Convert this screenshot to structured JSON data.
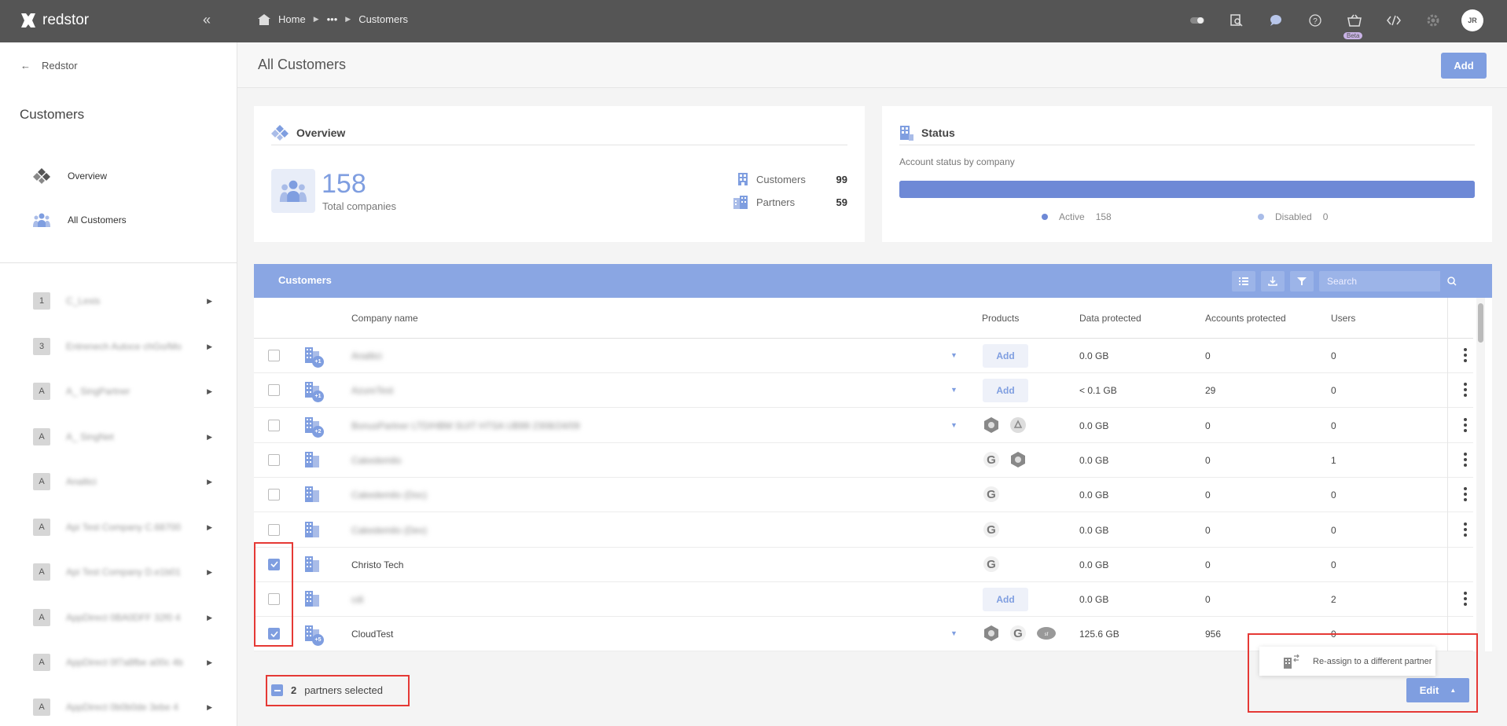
{
  "topbar": {
    "brand": "redstor",
    "breadcrumb": {
      "home": "Home",
      "ellipsis": "•••",
      "current": "Customers"
    },
    "beta_label": "Beta",
    "avatar_initials": "JR",
    "icons": [
      "toggle-icon",
      "search-doc-icon",
      "chat-icon",
      "help-icon",
      "basket-icon",
      "code-icon",
      "gear-icon"
    ]
  },
  "sidebar": {
    "back_label": "Redstor",
    "title": "Customers",
    "nav": [
      {
        "label": "Overview",
        "icon": "overview-icon"
      },
      {
        "label": "All Customers",
        "icon": "people-icon"
      }
    ],
    "list": [
      {
        "badge": "1",
        "label": "C_Lexis"
      },
      {
        "badge": "3",
        "label": "Entrenech Autoce chGo/Mo"
      },
      {
        "badge": "A",
        "label": "A_ SingPartner"
      },
      {
        "badge": "A",
        "label": "A_ SingNet"
      },
      {
        "badge": "A",
        "label": "Analtici"
      },
      {
        "badge": "A",
        "label": "Api Test Company C.68700"
      },
      {
        "badge": "A",
        "label": "Api Test Company D.e1b01"
      },
      {
        "badge": "A",
        "label": "AppDirect 0BA0DFF 32f0 4"
      },
      {
        "badge": "A",
        "label": "AppDirect 0f7a8fbe a00c 4b"
      },
      {
        "badge": "A",
        "label": "AppDirect 0b0b0de 3ebe 4"
      }
    ]
  },
  "page": {
    "title": "All Customers",
    "add_label": "Add"
  },
  "overview": {
    "title": "Overview",
    "total": "158",
    "total_label": "Total companies",
    "customers_label": "Customers",
    "customers_count": "99",
    "partners_label": "Partners",
    "partners_count": "59"
  },
  "status": {
    "title": "Status",
    "subtitle": "Account status by company",
    "active_label": "Active",
    "active_count": "158",
    "disabled_label": "Disabled",
    "disabled_count": "0",
    "active_fraction": 1.0,
    "colors": {
      "active": "#6e89d6",
      "disabled": "#a9bce8"
    }
  },
  "table": {
    "title": "Customers",
    "search_placeholder": "Search",
    "columns": {
      "name": "Company name",
      "products": "Products",
      "data": "Data protected",
      "accounts": "Accounts protected",
      "users": "Users"
    },
    "rows": [
      {
        "name": "Analtici",
        "blur": true,
        "badge": "+1",
        "caret": true,
        "products": "add",
        "data": "0.0 GB",
        "accounts": "0",
        "users": "0",
        "checked": false,
        "kebab": true
      },
      {
        "name": "AzureTest",
        "blur": true,
        "badge": "+1",
        "caret": true,
        "products": "add",
        "data": "< 0.1 GB",
        "accounts": "29",
        "users": "0",
        "checked": false,
        "kebab": true
      },
      {
        "name": "BonusPartner LTD/HBM SUIT HTSA UB99 2308/24/09",
        "blur": true,
        "badge": "+2",
        "caret": true,
        "products": [
          "hex-product-icon",
          "recycle-product-icon"
        ],
        "data": "0.0 GB",
        "accounts": "0",
        "users": "0",
        "checked": false,
        "kebab": true
      },
      {
        "name": "Cakedemilo",
        "blur": true,
        "badge": "",
        "caret": false,
        "products": [
          "google-product-icon",
          "hex-product-icon"
        ],
        "data": "0.0 GB",
        "accounts": "0",
        "users": "1",
        "checked": false,
        "kebab": true
      },
      {
        "name": "Cakedemilo (Doc)",
        "blur": true,
        "badge": "",
        "caret": false,
        "products": [
          "google-product-icon"
        ],
        "data": "0.0 GB",
        "accounts": "0",
        "users": "0",
        "checked": false,
        "kebab": true
      },
      {
        "name": "Cakedemilo (Dev)",
        "blur": true,
        "badge": "",
        "caret": false,
        "products": [
          "google-product-icon"
        ],
        "data": "0.0 GB",
        "accounts": "0",
        "users": "0",
        "checked": false,
        "kebab": true
      },
      {
        "name": "Christo Tech",
        "blur": false,
        "badge": "",
        "caret": false,
        "products": [
          "google-product-icon"
        ],
        "data": "0.0 GB",
        "accounts": "0",
        "users": "0",
        "checked": true,
        "kebab": false
      },
      {
        "name": "cdi",
        "blur": true,
        "badge": "",
        "caret": false,
        "products": "add",
        "data": "0.0 GB",
        "accounts": "0",
        "users": "2",
        "checked": false,
        "kebab": true
      },
      {
        "name": "CloudTest",
        "blur": false,
        "badge": "+5",
        "caret": true,
        "products": [
          "hex-product-icon",
          "google-product-icon",
          "salesforce-product-icon"
        ],
        "data": "125.6 GB",
        "accounts": "956",
        "users": "0",
        "checked": true,
        "kebab": false
      }
    ],
    "add_product_label": "Add"
  },
  "selection": {
    "count": "2",
    "label": "partners selected"
  },
  "edit_menu": {
    "reassign_label": "Re-assign to a different partner",
    "edit_label": "Edit"
  }
}
